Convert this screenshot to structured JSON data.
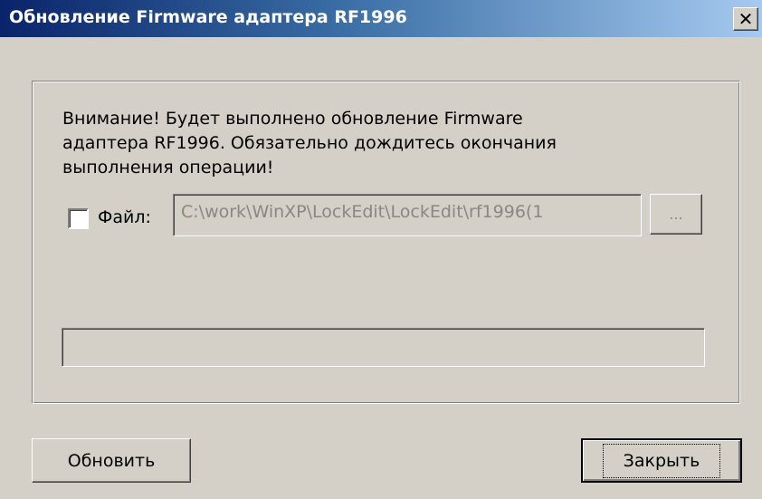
{
  "window": {
    "title": "Обновление Firmware адаптера RF1996",
    "close_glyph": "✕"
  },
  "content": {
    "warning_text": "Внимание! Будет выполнено обновление Firmware\nадаптера RF1996. Обязательно дождитесь окончания\nвыполнения операции!",
    "file_checkbox_checked": false,
    "file_label": "Файл:",
    "file_path_value": "C:\\work\\WinXP\\LockEdit\\LockEdit\\rf1996(1",
    "browse_label": "...",
    "progress_percent": 0
  },
  "buttons": {
    "update_label": "Обновить",
    "close_label": "Закрыть"
  },
  "colors": {
    "face": "#d4d0c8",
    "title_start": "#0a246a",
    "title_end": "#a6caf0",
    "disabled_text": "#8a8780"
  }
}
